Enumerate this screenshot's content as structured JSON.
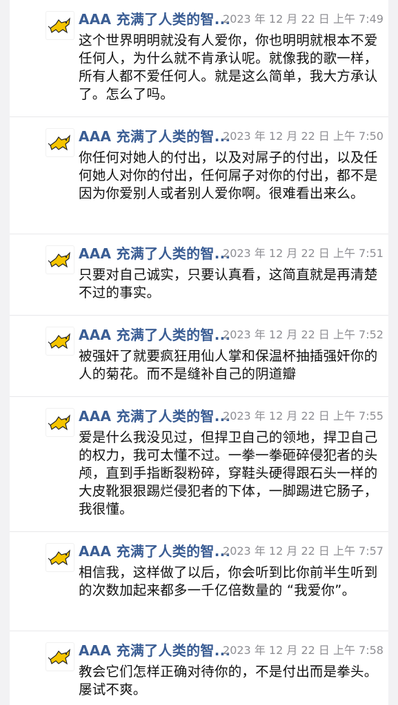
{
  "messages": [
    {
      "sender": "AAA 充满了人类的智...",
      "time": "2023 年 12 月 22 日 上午 7:49",
      "text": "这个世界明明就没有人爱你，你也明明就根本不爱任何人，为什么就不肯承认呢。就像我的歌一样，所有人都不爱任何人。就是这么简单，我大方承认了。怎么了吗。"
    },
    {
      "sender": "AAA 充满了人类的智...",
      "time": "2023 年 12 月 22 日 上午 7:50",
      "text": "你任何对她人的付出，以及对屌子的付出，以及任何她人对你的付出，任何屌子对你的付出，都不是因为你爱别人或者别人爱你啊。很难看出来么。"
    },
    {
      "sender": "AAA 充满了人类的智...",
      "time": "2023 年 12 月 22 日 上午 7:51",
      "text": "只要对自己诚实，只要认真看，这简直就是再清楚不过的事实。"
    },
    {
      "sender": "AAA 充满了人类的智...",
      "time": "2023 年 12 月 22 日 上午 7:52",
      "text": "被强奸了就要疯狂用仙人掌和保温杯抽插强奸你的人的菊花。而不是缝补自己的阴道瓣"
    },
    {
      "sender": "AAA 充满了人类的智...",
      "time": "2023 年 12 月 22 日 上午 7:55",
      "text": "爱是什么我没见过，但捍卫自己的领地，捍卫自己的权力，我可太懂不过。一拳一拳砸碎侵犯者的头颅，直到手指断裂粉碎，穿鞋头硬得跟石头一样的大皮靴狠狠踢烂侵犯者的下体，一脚踢进它肠子，我很懂。"
    },
    {
      "sender": "AAA 充满了人类的智...",
      "time": "2023 年 12 月 22 日 上午 7:57",
      "text": "相信我，这样做了以后，你会听到比你前半生听到的次数加起来都多一千亿倍数量的 “我爱你”。"
    },
    {
      "sender": "AAA 充满了人类的智...",
      "time": "2023 年 12 月 22 日 上午 7:58",
      "text": "教会它们怎样正确对待你的，不是付出而是拳头。屡试不爽。"
    }
  ],
  "avatar_icon": "yellow-cat-icon",
  "colors": {
    "sender": "#3a5d94",
    "time": "#8e8e93",
    "text": "#111111",
    "sidebar": "#f2f2f4",
    "avatar_fill": "#f5c400"
  }
}
